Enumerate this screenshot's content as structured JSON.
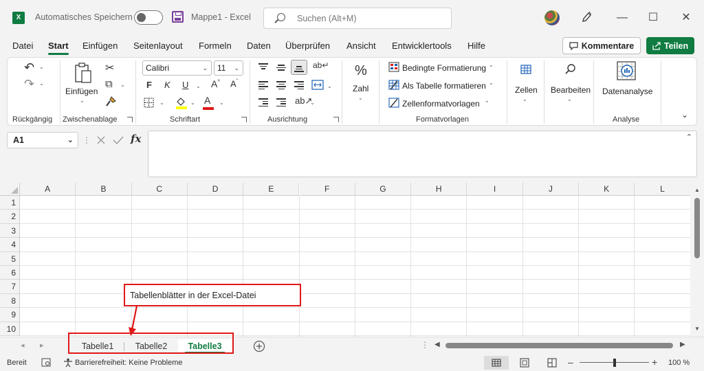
{
  "titlebar": {
    "app_icon_letter": "X",
    "autosave_label": "Automatisches Speichern",
    "doc_title": "Mappe1  -  Excel",
    "search_placeholder": "Suchen (Alt+M)",
    "minimize": "—",
    "maximize": "☐",
    "close": "✕"
  },
  "tabs": [
    "Datei",
    "Start",
    "Einfügen",
    "Seitenlayout",
    "Formeln",
    "Daten",
    "Überprüfen",
    "Ansicht",
    "Entwicklertools",
    "Hilfe"
  ],
  "active_tab": "Start",
  "actions": {
    "comments_label": "Kommentare",
    "share_label": "Teilen"
  },
  "ribbon": {
    "undo_group": "Rückgängig",
    "clipboard": {
      "label": "Zwischenablage",
      "paste_label": "Einfügen"
    },
    "font": {
      "label": "Schriftart",
      "font_name": "Calibri",
      "font_size": "11",
      "bold": "F",
      "italic": "K",
      "underline": "U"
    },
    "alignment": {
      "label": "Ausrichtung"
    },
    "number": {
      "label": "Zahl"
    },
    "styles": {
      "label": "Formatvorlagen",
      "conditional": "Bedingte Formatierung",
      "as_table": "Als Tabelle formatieren",
      "cell_styles": "Zellenformatvorlagen"
    },
    "cells": {
      "label": "Zellen"
    },
    "editing": {
      "label": "Bearbeiten"
    },
    "analysis": {
      "label": "Analyse",
      "data_analysis": "Datenanalyse"
    }
  },
  "formula_bar": {
    "name_box": "A1",
    "fx": "fx",
    "value": ""
  },
  "grid": {
    "columns": [
      "A",
      "B",
      "C",
      "D",
      "E",
      "F",
      "G",
      "H",
      "I",
      "J",
      "K",
      "L"
    ],
    "rows": [
      "1",
      "2",
      "3",
      "4",
      "5",
      "6",
      "7",
      "8",
      "9",
      "10"
    ]
  },
  "sheets": [
    "Tabelle1",
    "Tabelle2",
    "Tabelle3"
  ],
  "active_sheet": "Tabelle3",
  "statusbar": {
    "mode": "Bereit",
    "accessibility": "Barrierefreiheit: Keine Probleme",
    "zoom": "100 %"
  },
  "annotation": {
    "callout_text": "Tabellenblätter in der Excel-Datei",
    "color": "#e01818"
  },
  "colors": {
    "accent": "#107c41",
    "annotation": "#e01818"
  }
}
